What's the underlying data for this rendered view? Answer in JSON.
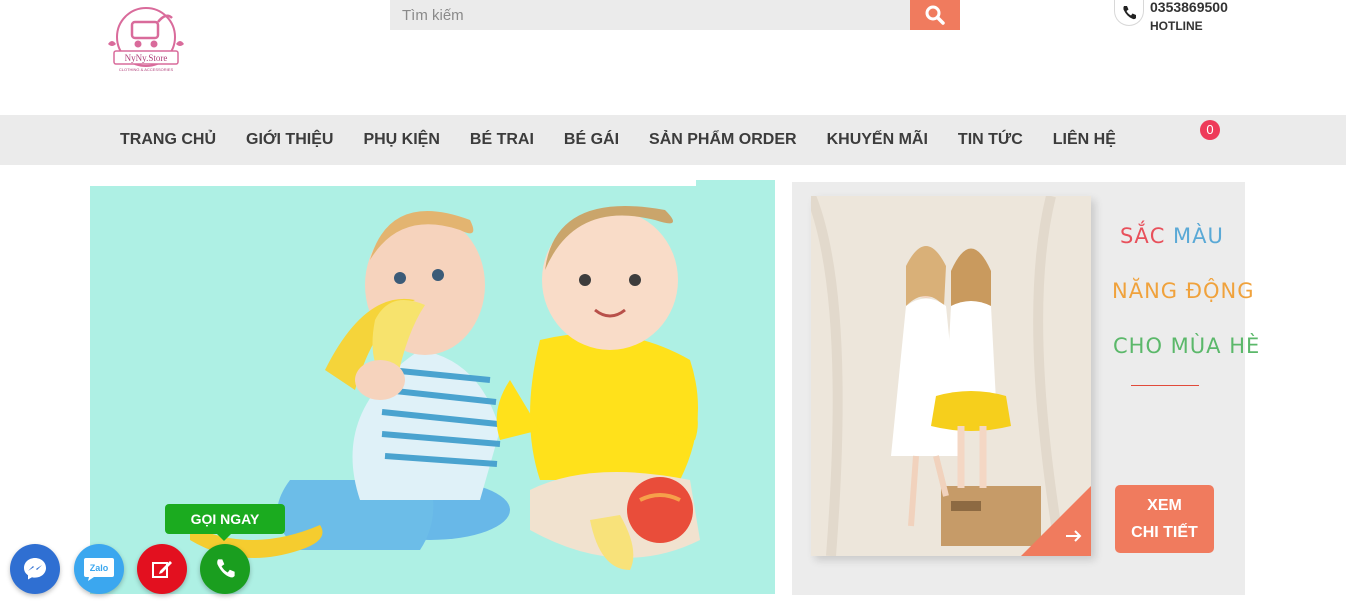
{
  "header": {
    "logo_text": "NyNy.Store",
    "logo_tagline": "CLOTHING & ACCESSORIES",
    "search": {
      "placeholder": "Tìm kiếm",
      "button_icon": "search-icon"
    },
    "hotline": {
      "number": "0353869500",
      "label": "HOTLINE",
      "icon": "phone-icon"
    }
  },
  "nav": {
    "items": [
      {
        "label": "TRANG CHỦ"
      },
      {
        "label": "GIỚI THIỆU"
      },
      {
        "label": "PHỤ KIỆN"
      },
      {
        "label": "BÉ TRAI"
      },
      {
        "label": "BÉ GÁI"
      },
      {
        "label": "SẢN PHẨM ORDER"
      },
      {
        "label": "KHUYẾN MÃI"
      },
      {
        "label": "TIN TỨC"
      },
      {
        "label": "LIÊN HỆ"
      }
    ],
    "cart_count": "0"
  },
  "promo": {
    "line1_a": "SẮC",
    "line1_b": "MÀU",
    "line2": "NĂNG ĐỘNG",
    "line3": "CHO MÙA HÈ",
    "button_line1": "XEM",
    "button_line2": "CHI TIẾT",
    "colors": {
      "red": "#e8505b",
      "blue": "#5aa9d6",
      "orange": "#f0a23c",
      "green": "#5bb86a",
      "accent": "#f07b5e"
    }
  },
  "floating": {
    "call_label": "GỌI NGAY",
    "zalo_text": "Zalo",
    "icons": [
      "messenger-icon",
      "zalo-icon",
      "edit-icon",
      "phone-icon"
    ]
  }
}
